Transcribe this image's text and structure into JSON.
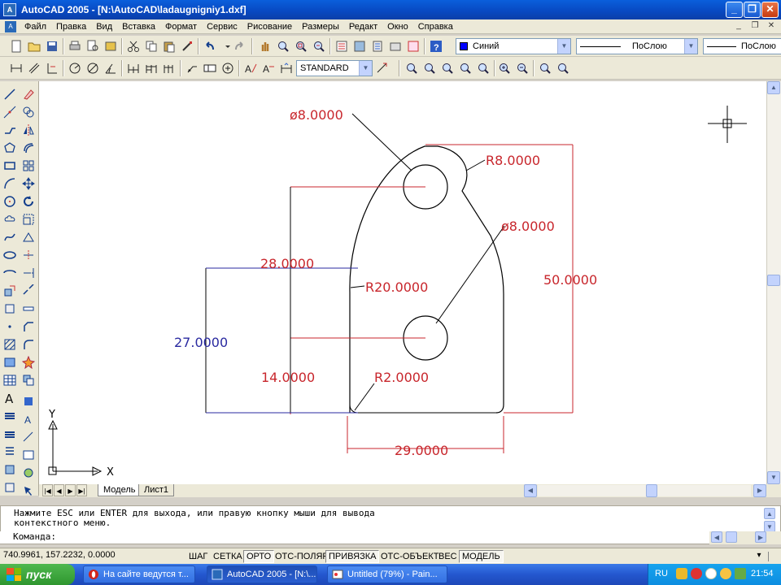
{
  "window": {
    "title": "AutoCAD 2005 - [N:\\AutoCAD\\ladaugnigniy1.dxf]",
    "app_icon": "autocad-icon"
  },
  "menu": [
    "Файл",
    "Правка",
    "Вид",
    "Вставка",
    "Формат",
    "Сервис",
    "Рисование",
    "Размеры",
    "Редакт",
    "Окно",
    "Справка"
  ],
  "toolbar": {
    "color_combo": "Синий",
    "linetype_combo": "ПоСлою",
    "lineweight_combo": "ПоСлою",
    "dimstyle_combo": "STANDARD"
  },
  "drawing": {
    "dims": {
      "dia_top": "ø8.0000",
      "r_top": "R8.0000",
      "dia_mid": "ø8.0000",
      "h_28": "28.0000",
      "r_20": "R20.0000",
      "h_50": "50.0000",
      "h_27": "27.0000",
      "h_14": "14.0000",
      "r_2": "R2.0000",
      "w_29": "29.0000"
    },
    "ucs": {
      "x_label": "X",
      "y_label": "Y"
    }
  },
  "tabs": [
    "Модель",
    "Лист1"
  ],
  "command": {
    "line1": "Нажмите ESC или ENTER для выхода, или правую кнопку мыши для вывода",
    "line2": "контекстного меню.",
    "prompt": "Команда:"
  },
  "status": {
    "coords": "740.9961, 157.2232, 0.0000",
    "buttons": [
      {
        "label": "ШАГ",
        "on": false
      },
      {
        "label": "СЕТКА",
        "on": false
      },
      {
        "label": "ОРТО",
        "on": true
      },
      {
        "label": "ОТС-ПОЛЯР",
        "on": false
      },
      {
        "label": "ПРИВЯЗКА",
        "on": true
      },
      {
        "label": "ОТС-ОБЪЕКТ",
        "on": false
      },
      {
        "label": "ВЕС",
        "on": false
      },
      {
        "label": "МОДЕЛЬ",
        "on": true
      }
    ]
  },
  "taskbar": {
    "start": "пуск",
    "tasks": [
      {
        "label": "На сайте ведутся т...",
        "icon": "opera-icon"
      },
      {
        "label": "AutoCAD 2005 - [N:\\...",
        "icon": "autocad-icon"
      },
      {
        "label": "Untitled (79%) - Pain...",
        "icon": "paint-icon"
      }
    ],
    "lang": "RU",
    "clock": "21:54"
  },
  "colors": {
    "dim_red": "#c8262c",
    "dim_blue": "#2a2aa0",
    "taskbar_blue": "#2457cf",
    "start_green": "#2f962f"
  }
}
